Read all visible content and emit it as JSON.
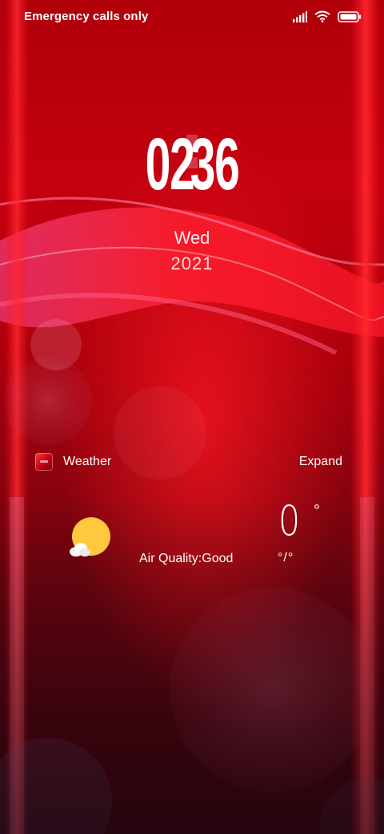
{
  "status_bar": {
    "carrier_text": "Emergency calls only",
    "icons": [
      "signal-icon",
      "wifi-icon",
      "battery-icon"
    ]
  },
  "clock": {
    "hours": "02",
    "minutes": "36",
    "day": "Wed",
    "year": "2021"
  },
  "weather_widget": {
    "title": "Weather",
    "expand_label": "Expand",
    "condition_icon": "partly-sunny-icon",
    "air_quality": "Air Quality:Good",
    "temperature": "0",
    "temperature_unit": "°",
    "range": "°/°"
  },
  "colors": {
    "wallpaper_primary": "#c4000f",
    "wallpaper_dark": "#3c0612",
    "sun": "#ffc83d",
    "text": "#ffffff"
  }
}
